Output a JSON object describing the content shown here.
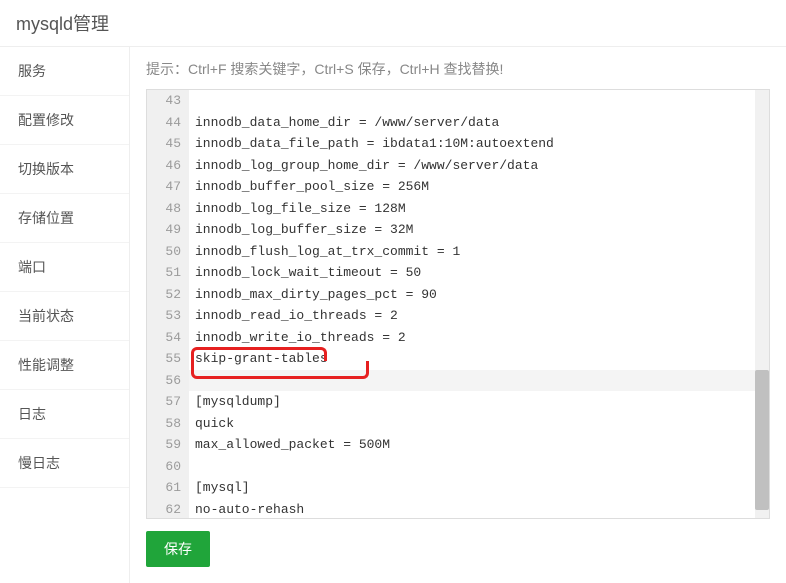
{
  "header": {
    "title": "mysqld管理"
  },
  "sidebar": {
    "items": [
      {
        "label": "服务"
      },
      {
        "label": "配置修改"
      },
      {
        "label": "切换版本"
      },
      {
        "label": "存储位置"
      },
      {
        "label": "端口"
      },
      {
        "label": "当前状态"
      },
      {
        "label": "性能调整"
      },
      {
        "label": "日志"
      },
      {
        "label": "慢日志"
      }
    ]
  },
  "main": {
    "hint": "提示：Ctrl+F 搜索关键字，Ctrl+S 保存，Ctrl+H 查找替换!",
    "save_label": "保存"
  },
  "editor": {
    "lines": [
      {
        "num": "43",
        "text": ""
      },
      {
        "num": "44",
        "text": "innodb_data_home_dir = /www/server/data"
      },
      {
        "num": "45",
        "text": "innodb_data_file_path = ibdata1:10M:autoextend"
      },
      {
        "num": "46",
        "text": "innodb_log_group_home_dir = /www/server/data"
      },
      {
        "num": "47",
        "text": "innodb_buffer_pool_size = 256M"
      },
      {
        "num": "48",
        "text": "innodb_log_file_size = 128M"
      },
      {
        "num": "49",
        "text": "innodb_log_buffer_size = 32M"
      },
      {
        "num": "50",
        "text": "innodb_flush_log_at_trx_commit = 1"
      },
      {
        "num": "51",
        "text": "innodb_lock_wait_timeout = 50"
      },
      {
        "num": "52",
        "text": "innodb_max_dirty_pages_pct = 90"
      },
      {
        "num": "53",
        "text": "innodb_read_io_threads = 2"
      },
      {
        "num": "54",
        "text": "innodb_write_io_threads = 2"
      },
      {
        "num": "55",
        "text": "skip-grant-tables"
      },
      {
        "num": "56",
        "text": ""
      },
      {
        "num": "57",
        "text": "[mysqldump]"
      },
      {
        "num": "58",
        "text": "quick"
      },
      {
        "num": "59",
        "text": "max_allowed_packet = 500M"
      },
      {
        "num": "60",
        "text": ""
      },
      {
        "num": "61",
        "text": "[mysql]"
      },
      {
        "num": "62",
        "text": "no-auto-rehash"
      }
    ],
    "highlighted_line": "56"
  }
}
